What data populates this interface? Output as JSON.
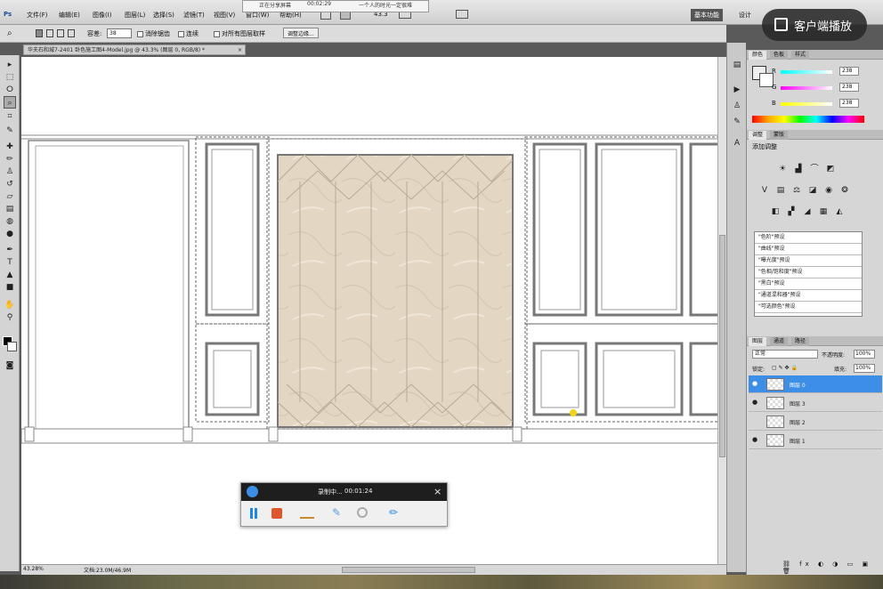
{
  "app": {
    "logo": "Ps",
    "menus": [
      "文件(F)",
      "编辑(E)",
      "图像(I)",
      "图层(L)",
      "选择(S)",
      "滤镜(T)",
      "视图(V)",
      "窗口(W)",
      "帮助(H)"
    ],
    "share_notice": {
      "line1": "正在分享屏幕",
      "time": "00:02:29",
      "line2": "一个人的时光一定很难"
    },
    "zoom_select": "43.3",
    "workspace": "基本功能",
    "design": "设计"
  },
  "options": {
    "tolerance_label": "容差:",
    "tolerance_value": "38",
    "antialias": "消除锯齿",
    "contiguous": "连续",
    "sample_all": "对所有图层取样",
    "refine_edge": "调整边缘..."
  },
  "document": {
    "tab": "华夫石和城7-2401 卧色施工图4-Model.jpg @ 43.3% (图层 0, RGB/8) *",
    "close": "×"
  },
  "status": {
    "zoom": "43.28%",
    "doc": "文档:23.0M/46.9M"
  },
  "panels": {
    "color_tabs": [
      "颜色",
      "色板",
      "样式"
    ],
    "rgb": [
      {
        "label": "R",
        "value": "238"
      },
      {
        "label": "G",
        "value": "238"
      },
      {
        "label": "B",
        "value": "238"
      }
    ],
    "adj_tabs": [
      "调整",
      "蒙版"
    ],
    "adj_title": "添加调整",
    "presets": [
      "\"色阶\"预设",
      "\"曲线\"预设",
      "\"曝光度\"预设",
      "\"色相/饱和度\"预设",
      "\"黑白\"预设",
      "\"通道混和器\"预设",
      "\"可选颜色\"预设"
    ],
    "layer_tabs": [
      "图层",
      "通道",
      "路径"
    ],
    "blend_mode": "正常",
    "opacity_label": "不透明度:",
    "opacity": "100%",
    "lock_label": "锁定:",
    "fill_label": "填充:",
    "fill": "100%",
    "layers": [
      {
        "name": "图层 0",
        "selected": true,
        "visible": true
      },
      {
        "name": "图层 3",
        "selected": false,
        "visible": true
      },
      {
        "name": "图层 2",
        "selected": false,
        "visible": false
      },
      {
        "name": "图层 1",
        "selected": false,
        "visible": true
      }
    ]
  },
  "recorder": {
    "status": "录制中...",
    "time": "00:01:24",
    "close": "×"
  },
  "cast": {
    "label": "客户端播放"
  },
  "colors": {
    "accent": "#3d8ee6",
    "marble": "#e3d6c3",
    "rec_red": "#e0562c",
    "pause_blue": "#1e88e5"
  }
}
